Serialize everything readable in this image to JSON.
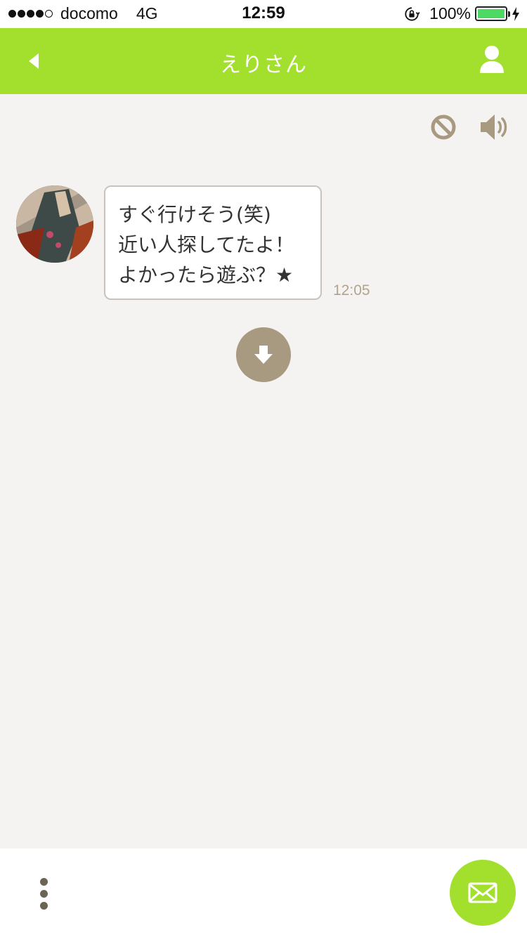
{
  "status_bar": {
    "carrier": "docomo",
    "network": "4G",
    "time": "12:59",
    "battery_percent": "100%",
    "battery_level": 1.0,
    "signal_bars_filled": 4,
    "signal_bars_total": 5
  },
  "header": {
    "title": "えりさん",
    "back_icon": "back-arrow-icon",
    "profile_icon": "person-icon",
    "background_color": "#a3e02d"
  },
  "actions": {
    "block_icon": "block-icon",
    "sound_icon": "speaker-icon",
    "icon_color": "#a89a80"
  },
  "message": {
    "lines": [
      "すぐ行けそう(笑)",
      "近い人探してたよ！",
      "よかったら遊ぶ？★"
    ],
    "time": "12:05"
  },
  "scroll_button": {
    "icon": "arrow-down-icon"
  },
  "bottom_bar": {
    "more_icon": "more-vertical-icon",
    "compose_icon": "mail-icon",
    "compose_color": "#a3e02d"
  }
}
